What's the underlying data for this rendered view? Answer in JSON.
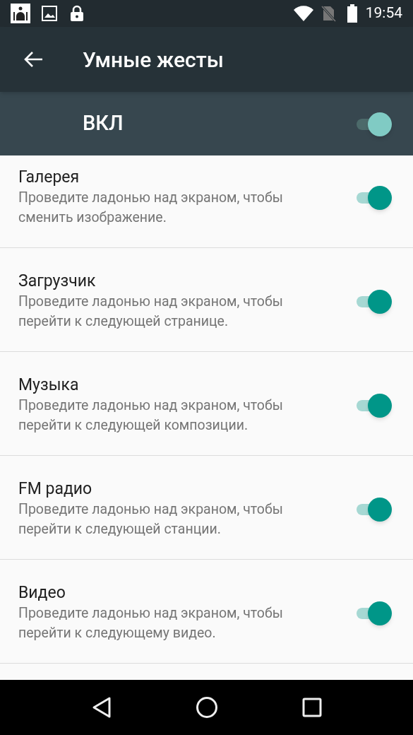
{
  "status_bar": {
    "time": "19:54"
  },
  "app_bar": {
    "title": "Умные жесты"
  },
  "master_switch": {
    "label": "ВКЛ",
    "on": true
  },
  "settings": [
    {
      "title": "Галерея",
      "description": "Проведите ладонью над экраном, чтобы сменить изображение.",
      "on": true
    },
    {
      "title": "Загрузчик",
      "description": "Проведите ладонью над экраном, чтобы перейти к следующей странице.",
      "on": true
    },
    {
      "title": "Музыка",
      "description": "Проведите ладонью над экраном, чтобы перейти к следующей композиции.",
      "on": true
    },
    {
      "title": "FM радио",
      "description": "Проведите ладонью над экраном, чтобы перейти к следующей станции.",
      "on": true
    },
    {
      "title": "Видео",
      "description": "Проведите ладонью над экраном, чтобы перейти к следующему видео.",
      "on": true
    }
  ]
}
